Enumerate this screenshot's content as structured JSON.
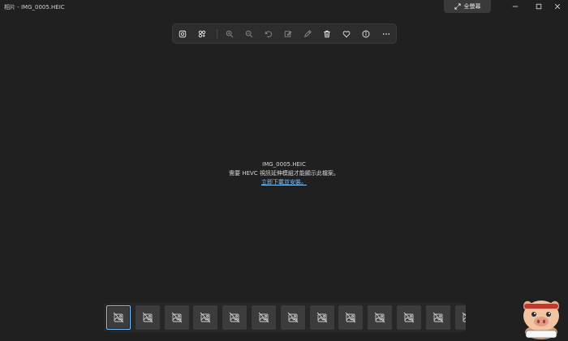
{
  "window": {
    "title": "相片 - IMG_0005.HEIC",
    "fullscreen_label": "全螢幕"
  },
  "toolbar": {
    "tools": [
      {
        "name": "enhance",
        "icon": "enhance-icon",
        "enabled": true
      },
      {
        "name": "edit-with-app",
        "icon": "apps-icon",
        "enabled": true
      },
      {
        "name": "zoom-in",
        "icon": "zoom-in-icon",
        "enabled": false
      },
      {
        "name": "zoom-out",
        "icon": "zoom-out-icon",
        "enabled": false
      },
      {
        "name": "rotate",
        "icon": "rotate-icon",
        "enabled": false
      },
      {
        "name": "edit-image",
        "icon": "edit-image-icon",
        "enabled": false
      },
      {
        "name": "draw",
        "icon": "pen-icon",
        "enabled": false
      },
      {
        "name": "delete",
        "icon": "trash-icon",
        "enabled": true
      },
      {
        "name": "favorite",
        "icon": "heart-icon",
        "enabled": true
      },
      {
        "name": "info",
        "icon": "info-icon",
        "enabled": true
      },
      {
        "name": "more",
        "icon": "more-icon",
        "enabled": true
      }
    ]
  },
  "viewer": {
    "filename": "IMG_0005.HEIC",
    "message": "需要 HEVC 視訊延伸模組才能顯示此檔案。",
    "link": "立即下載並安裝。"
  },
  "filmstrip": {
    "count": 13,
    "selected_index": 0
  },
  "colors": {
    "background": "#202020",
    "accent": "#7fc3ff"
  }
}
